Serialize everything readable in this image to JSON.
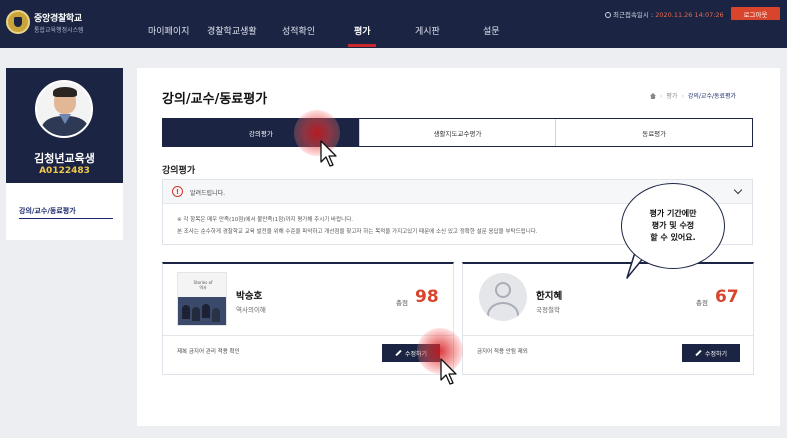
{
  "header": {
    "school_name": "중앙경찰학교",
    "system_name": "통합교육행정시스템",
    "nav": [
      "마이페이지",
      "경찰학교생활",
      "성적확인",
      "평가",
      "게시판",
      "설문"
    ],
    "active_nav": "평가",
    "last_login_label": "최근접속일시 :",
    "last_login_value": "2020.11.26 14:07:26",
    "logout_label": "로그아웃"
  },
  "profile": {
    "name": "김청년교육생",
    "student_id": "A0122483",
    "menu_item": "강의/교수/동료평가"
  },
  "page": {
    "title": "강의/교수/동료평가",
    "breadcrumb": [
      "평가",
      "강의/교수/동료평가"
    ],
    "tabs": [
      "강의평가",
      "생활지도교수평가",
      "동료평가"
    ],
    "active_tab": "강의평가",
    "section_title": "강의평가"
  },
  "notice": {
    "label": "알려드립니다.",
    "line1": "※ 각 항목은 매우 만족(10점)에서 불만족(1점)까지 평가해 주시기 바랍니다.",
    "line2": "본 조사는 순수하게 경찰학교 교육 발전을 위해 수준을 파악하고 개선점을 찾고자 하는 목적을 가지고있기 때문에 소신 있고 정확한 설문 응답을 부탁드립니다."
  },
  "cards": [
    {
      "name": "박승호",
      "course": "역사의이해",
      "score_label": "총점",
      "score": "98",
      "book_title": "Stories of\n역사",
      "note": "제복 금지어 관리 적용 확인",
      "button": "수정하기"
    },
    {
      "name": "한지혜",
      "course": "국정철학",
      "score_label": "총점",
      "score": "67",
      "note": "금지어 적용 안됨 제외",
      "button": "수정하기"
    }
  ],
  "tooltip": "평가 기간에만\n평가 및 수정\n할 수 있어요.",
  "colors": {
    "navy": "#1b2442",
    "accent": "#d8452c",
    "gold": "#f0c94a"
  }
}
